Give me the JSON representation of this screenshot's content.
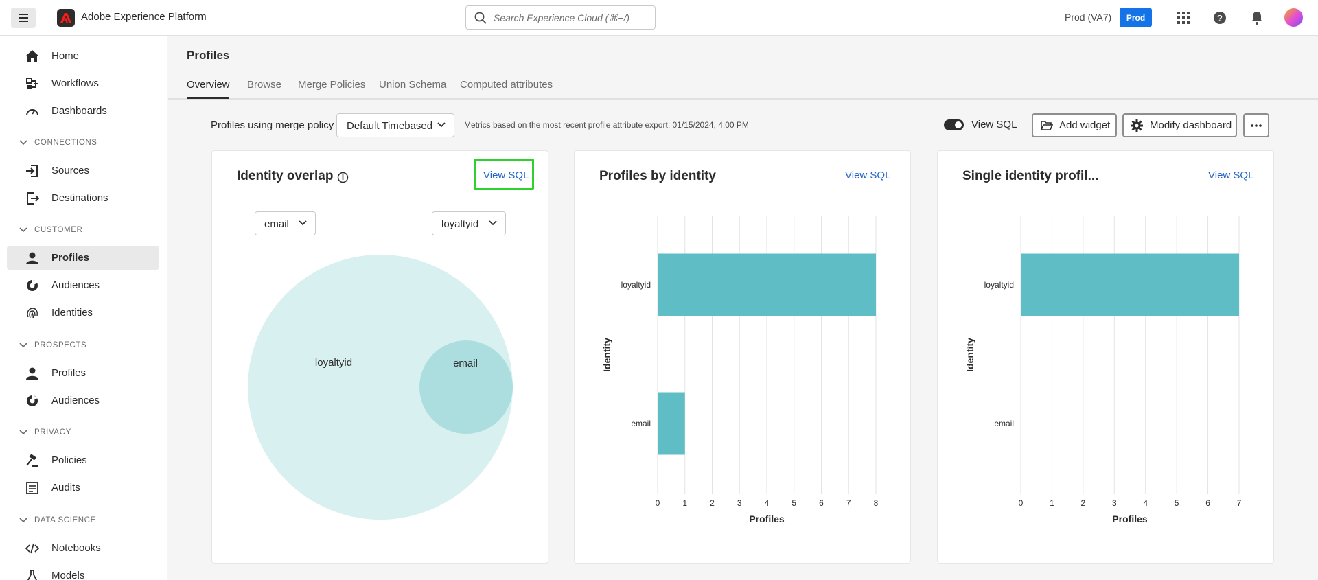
{
  "topbar": {
    "app_title": "Adobe Experience Platform",
    "search_placeholder": "Search Experience Cloud (⌘+/)",
    "org_name": "Prod (VA7)",
    "sandbox_badge": "Prod"
  },
  "sidebar": {
    "home": "Home",
    "workflows": "Workflows",
    "dashboards": "Dashboards",
    "connections_header": "CONNECTIONS",
    "sources": "Sources",
    "destinations": "Destinations",
    "customer_header": "CUSTOMER",
    "profiles": "Profiles",
    "audiences": "Audiences",
    "identities": "Identities",
    "prospects_header": "PROSPECTS",
    "prospect_profiles": "Profiles",
    "prospect_audiences": "Audiences",
    "privacy_header": "PRIVACY",
    "policies": "Policies",
    "audits": "Audits",
    "data_science_header": "DATA SCIENCE",
    "notebooks": "Notebooks",
    "models": "Models"
  },
  "page": {
    "title": "Profiles",
    "tabs": [
      "Overview",
      "Browse",
      "Merge Policies",
      "Union Schema",
      "Computed attributes"
    ],
    "active_tab": "Overview"
  },
  "controls": {
    "merge_policy_label": "Profiles using merge policy",
    "merge_policy_value": "Default Timebased",
    "metrics_note": "Metrics based on the most recent profile attribute export: 01/15/2024, 4:00 PM",
    "view_sql_toggle_label": "View SQL",
    "add_widget": "Add widget",
    "modify_dashboard": "Modify dashboard"
  },
  "cards": {
    "identity_overlap": {
      "title": "Identity overlap",
      "view_sql": "View SQL",
      "left_select": "email",
      "right_select": "loyaltyid",
      "circle_large_label": "loyaltyid",
      "circle_small_label": "email"
    },
    "profiles_by_identity": {
      "title": "Profiles by identity",
      "view_sql": "View SQL"
    },
    "single_identity": {
      "title": "Single identity profil...",
      "view_sql": "View SQL"
    }
  },
  "chart_data": [
    {
      "type": "bar",
      "orientation": "horizontal",
      "title": "Profiles by identity",
      "categories": [
        "loyaltyid",
        "email"
      ],
      "values": [
        8,
        1
      ],
      "xlabel": "Profiles",
      "ylabel": "Identity",
      "xlim": [
        0,
        8
      ],
      "ticks": [
        "0",
        "1",
        "2",
        "3",
        "4",
        "5",
        "6",
        "7",
        "8"
      ],
      "color": "#5fbec5",
      "grid": true
    },
    {
      "type": "bar",
      "orientation": "horizontal",
      "title": "Single identity profil...",
      "categories": [
        "loyaltyid",
        "email"
      ],
      "values": [
        7,
        0
      ],
      "xlabel": "Profiles",
      "ylabel": "Identity",
      "xlim": [
        0,
        7
      ],
      "ticks": [
        "0",
        "1",
        "2",
        "3",
        "4",
        "5",
        "6",
        "7"
      ],
      "color": "#5fbec5",
      "grid": true
    }
  ]
}
